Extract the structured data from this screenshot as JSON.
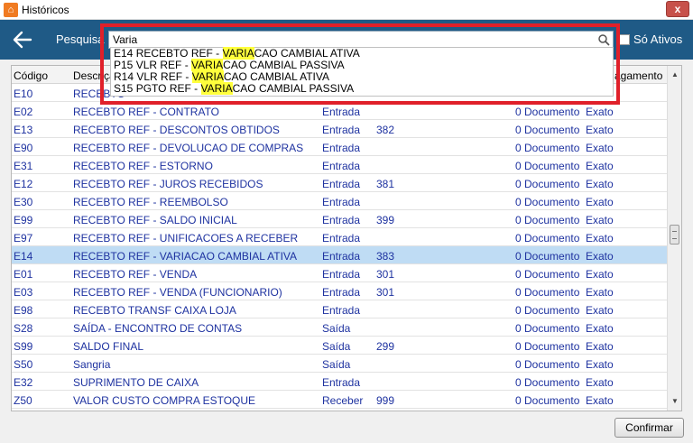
{
  "window": {
    "title": "Históricos",
    "close_label": "x"
  },
  "toolbar": {
    "search_label": "Pesquisa",
    "search_value": "Varia",
    "so_ativos_label": "Só Ativos"
  },
  "suggestions": [
    {
      "code": "E14",
      "prefix": "RECEBTO REF - ",
      "match": "VARIA",
      "suffix": "CAO CAMBIAL ATIVA"
    },
    {
      "code": "P15",
      "prefix": "VLR REF - ",
      "match": "VARIA",
      "suffix": "CAO CAMBIAL PASSIVA"
    },
    {
      "code": "R14",
      "prefix": "VLR REF - ",
      "match": "VARIA",
      "suffix": "CAO CAMBIAL ATIVA"
    },
    {
      "code": "S15",
      "prefix": "PGTO REF - ",
      "match": "VARIA",
      "suffix": "CAO CAMBIAL PASSIVA"
    }
  ],
  "table": {
    "headers": {
      "codigo": "Código",
      "descricao": "Descriçã",
      "pagamento": "agamento"
    },
    "rows": [
      {
        "codigo": "E10",
        "descricao": "RECEBTO",
        "tipo": "",
        "conta": "",
        "documento": "",
        "pagamento": ""
      },
      {
        "codigo": "E02",
        "descricao": "RECEBTO REF - CONTRATO",
        "tipo": "Entrada",
        "conta": "",
        "documento": "0 Documento",
        "pagamento": "Exato"
      },
      {
        "codigo": "E13",
        "descricao": "RECEBTO REF - DESCONTOS OBTIDOS",
        "tipo": "Entrada",
        "conta": "382",
        "documento": "0 Documento",
        "pagamento": "Exato"
      },
      {
        "codigo": "E90",
        "descricao": "RECEBTO REF - DEVOLUCAO DE COMPRAS",
        "tipo": "Entrada",
        "conta": "",
        "documento": "0 Documento",
        "pagamento": "Exato"
      },
      {
        "codigo": "E31",
        "descricao": "RECEBTO REF - ESTORNO",
        "tipo": "Entrada",
        "conta": "",
        "documento": "0 Documento",
        "pagamento": "Exato"
      },
      {
        "codigo": "E12",
        "descricao": "RECEBTO REF - JUROS RECEBIDOS",
        "tipo": "Entrada",
        "conta": "381",
        "documento": "0 Documento",
        "pagamento": "Exato"
      },
      {
        "codigo": "E30",
        "descricao": "RECEBTO REF - REEMBOLSO",
        "tipo": "Entrada",
        "conta": "",
        "documento": "0 Documento",
        "pagamento": "Exato"
      },
      {
        "codigo": "E99",
        "descricao": "RECEBTO REF - SALDO INICIAL",
        "tipo": "Entrada",
        "conta": "399",
        "documento": "0 Documento",
        "pagamento": "Exato"
      },
      {
        "codigo": "E97",
        "descricao": "RECEBTO REF - UNIFICACOES A RECEBER",
        "tipo": "Entrada",
        "conta": "",
        "documento": "0 Documento",
        "pagamento": "Exato"
      },
      {
        "codigo": "E14",
        "descricao": "RECEBTO REF - VARIACAO CAMBIAL ATIVA",
        "tipo": "Entrada",
        "conta": "383",
        "documento": "0 Documento",
        "pagamento": "Exato",
        "selected": true
      },
      {
        "codigo": "E01",
        "descricao": "RECEBTO REF - VENDA",
        "tipo": "Entrada",
        "conta": "301",
        "documento": "0 Documento",
        "pagamento": "Exato"
      },
      {
        "codigo": "E03",
        "descricao": "RECEBTO REF - VENDA (FUNCIONARIO)",
        "tipo": "Entrada",
        "conta": "301",
        "documento": "0 Documento",
        "pagamento": "Exato"
      },
      {
        "codigo": "E98",
        "descricao": "RECEBTO TRANSF CAIXA LOJA",
        "tipo": "Entrada",
        "conta": "",
        "documento": "0 Documento",
        "pagamento": "Exato"
      },
      {
        "codigo": "S28",
        "descricao": "SAÍDA - ENCONTRO DE CONTAS",
        "tipo": "Saída",
        "conta": "",
        "documento": "0 Documento",
        "pagamento": "Exato"
      },
      {
        "codigo": "S99",
        "descricao": "SALDO FINAL",
        "tipo": "Saída",
        "conta": "299",
        "documento": "0 Documento",
        "pagamento": "Exato"
      },
      {
        "codigo": "S50",
        "descricao": "Sangria",
        "tipo": "Saída",
        "conta": "",
        "documento": "0 Documento",
        "pagamento": "Exato"
      },
      {
        "codigo": "E32",
        "descricao": "SUPRIMENTO DE CAIXA",
        "tipo": "Entrada",
        "conta": "",
        "documento": "0 Documento",
        "pagamento": "Exato"
      },
      {
        "codigo": "Z50",
        "descricao": "VALOR CUSTO COMPRA ESTOQUE",
        "tipo": "Receber",
        "conta": "999",
        "documento": "0 Documento",
        "pagamento": "Exato"
      }
    ]
  },
  "footer": {
    "confirm_label": "Confirmar"
  },
  "colors": {
    "toolbar": "#1f5a86",
    "highlight": "#ffff3c",
    "frame": "#e0202a",
    "selected_row": "#bfdcf4",
    "row_text": "#1e32a0"
  }
}
